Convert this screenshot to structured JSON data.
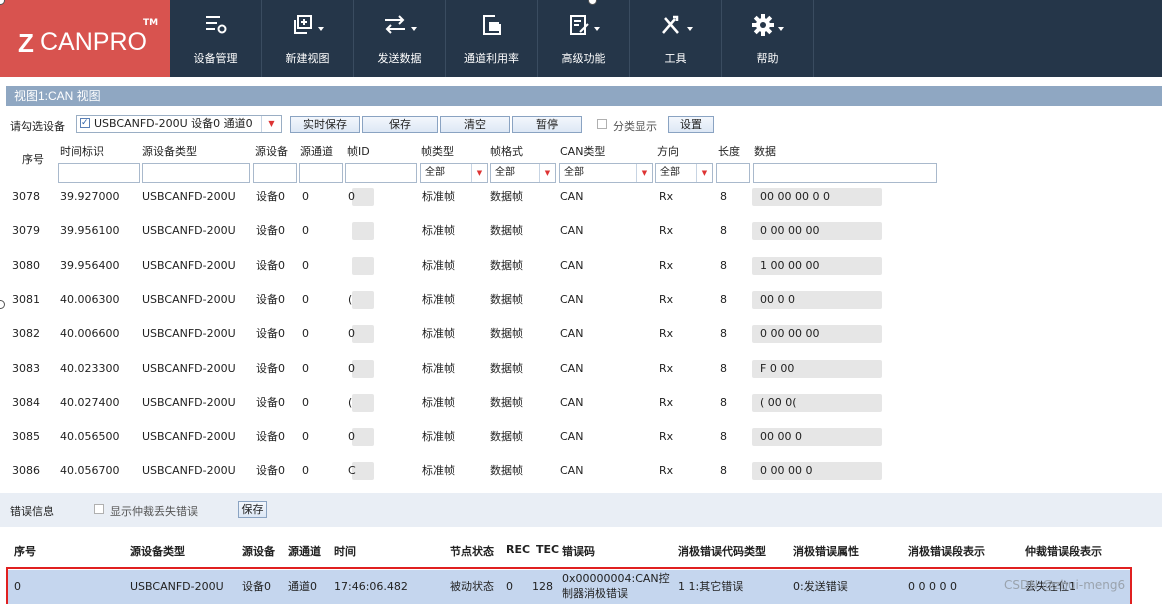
{
  "app": {
    "logo_text": "CANPRO",
    "logo_z": "Z",
    "logo_tm": "TM",
    "ribbon": [
      {
        "label": "设备管理",
        "icon": "device-manage-icon"
      },
      {
        "label": "新建视图",
        "icon": "new-view-icon"
      },
      {
        "label": "发送数据",
        "icon": "send-data-icon"
      },
      {
        "label": "通道利用率",
        "icon": "channel-usage-icon"
      },
      {
        "label": "高级功能",
        "icon": "advanced-icon"
      },
      {
        "label": "工具",
        "icon": "tools-icon"
      },
      {
        "label": "帮助",
        "icon": "help-icon"
      }
    ],
    "colors": {
      "ribbon_bg": "#253649",
      "logo_bg": "#d8534f",
      "view_bar": "#8fa7c2",
      "error_row": "#c5d6ee",
      "highlight_border": "#e02020"
    }
  },
  "view": {
    "title": "视图1:CAN 视图"
  },
  "toolbar": {
    "device_label": "请勾选设备",
    "device_value": "USBCANFD-200U 设备0 通道0",
    "realtime_save": "实时保存",
    "save": "保存",
    "clear": "清空",
    "pause": "暂停",
    "classify_label": "分类显示",
    "settings": "设置"
  },
  "frame_table": {
    "headers": {
      "seq": "序号",
      "time": "时间标识",
      "src_type": "源设备类型",
      "src_dev": "源设备",
      "src_ch": "源通道",
      "frame_id": "帧ID",
      "frame_type": "帧类型",
      "frame_fmt": "帧格式",
      "can_type": "CAN类型",
      "dir": "方向",
      "len": "长度",
      "data": "数据"
    },
    "filters": {
      "frame_type": "全部",
      "frame_fmt": "全部",
      "can_type": "全部",
      "dir": "全部"
    },
    "rows": [
      {
        "seq": "3078",
        "time": "39.927000",
        "type": "USBCANFD-200U",
        "dev": "设备0",
        "ch": "0",
        "id": "0",
        "ftype": "标准帧",
        "fmt": "数据帧",
        "can": "CAN",
        "dir": "Rx",
        "len": "8",
        "data": "00 00 00 0    0"
      },
      {
        "seq": "3079",
        "time": "39.956100",
        "type": "USBCANFD-200U",
        "dev": "设备0",
        "ch": "0",
        "id": "",
        "ftype": "标准帧",
        "fmt": "数据帧",
        "can": "CAN",
        "dir": "Rx",
        "len": "8",
        "data": "0 00       00 00"
      },
      {
        "seq": "3080",
        "time": "39.956400",
        "type": "USBCANFD-200U",
        "dev": "设备0",
        "ch": "0",
        "id": "",
        "ftype": "标准帧",
        "fmt": "数据帧",
        "can": "CAN",
        "dir": "Rx",
        "len": "8",
        "data": "1          00 00 00"
      },
      {
        "seq": "3081",
        "time": "40.006300",
        "type": "USBCANFD-200U",
        "dev": "设备0",
        "ch": "0",
        "id": "(",
        "ftype": "标准帧",
        "fmt": "数据帧",
        "can": "CAN",
        "dir": "Rx",
        "len": "8",
        "data": "00 0      0"
      },
      {
        "seq": "3082",
        "time": "40.006600",
        "type": "USBCANFD-200U",
        "dev": "设备0",
        "ch": "0",
        "id": "0",
        "ftype": "标准帧",
        "fmt": "数据帧",
        "can": "CAN",
        "dir": "Rx",
        "len": "8",
        "data": "0 00 00 00"
      },
      {
        "seq": "3083",
        "time": "40.023300",
        "type": "USBCANFD-200U",
        "dev": "设备0",
        "ch": "0",
        "id": "0",
        "ftype": "标准帧",
        "fmt": "数据帧",
        "can": "CAN",
        "dir": "Rx",
        "len": "8",
        "data": "F    0 00"
      },
      {
        "seq": "3084",
        "time": "40.027400",
        "type": "USBCANFD-200U",
        "dev": "设备0",
        "ch": "0",
        "id": "(",
        "ftype": "标准帧",
        "fmt": "数据帧",
        "can": "CAN",
        "dir": "Rx",
        "len": "8",
        "data": "(     00 0("
      },
      {
        "seq": "3085",
        "time": "40.056500",
        "type": "USBCANFD-200U",
        "dev": "设备0",
        "ch": "0",
        "id": "0",
        "ftype": "标准帧",
        "fmt": "数据帧",
        "can": "CAN",
        "dir": "Rx",
        "len": "8",
        "data": "00     00       0"
      },
      {
        "seq": "3086",
        "time": "40.056700",
        "type": "USBCANFD-200U",
        "dev": "设备0",
        "ch": "0",
        "id": "C",
        "ftype": "标准帧",
        "fmt": "数据帧",
        "can": "CAN",
        "dir": "Rx",
        "len": "8",
        "data": "0 00 00        0"
      }
    ]
  },
  "error_panel": {
    "title": "错误信息",
    "show_arb_lost": "显示仲裁丢失错误",
    "save": "保存",
    "headers": {
      "seq": "序号",
      "src_type": "源设备类型",
      "src_dev": "源设备",
      "src_ch": "源通道",
      "time": "时间",
      "node_state": "节点状态",
      "rec": "REC",
      "tec": "TEC",
      "err_code": "错误码",
      "passive_code_type": "消极错误代码类型",
      "passive_attr": "消极错误属性",
      "passive_seg": "消极错误段表示",
      "arb_seg": "仲裁错误段表示"
    },
    "row": {
      "seq": "0",
      "src_type": "USBCANFD-200U",
      "src_dev": "设备0",
      "src_ch": "通道0",
      "time": "17:46:06.482",
      "node_state": "被动状态",
      "rec": "0",
      "tec": "128",
      "err_code_1": "0x00000004:CAN控",
      "err_code_2": "制器消极错误",
      "passive_code_type": "1 1:其它错误",
      "passive_attr": "0:发送错误",
      "passive_seg": "0 0 0 0 0",
      "arb_seg": "丢失在位1"
    },
    "watermark": "CSDN @zhui-meng6"
  }
}
